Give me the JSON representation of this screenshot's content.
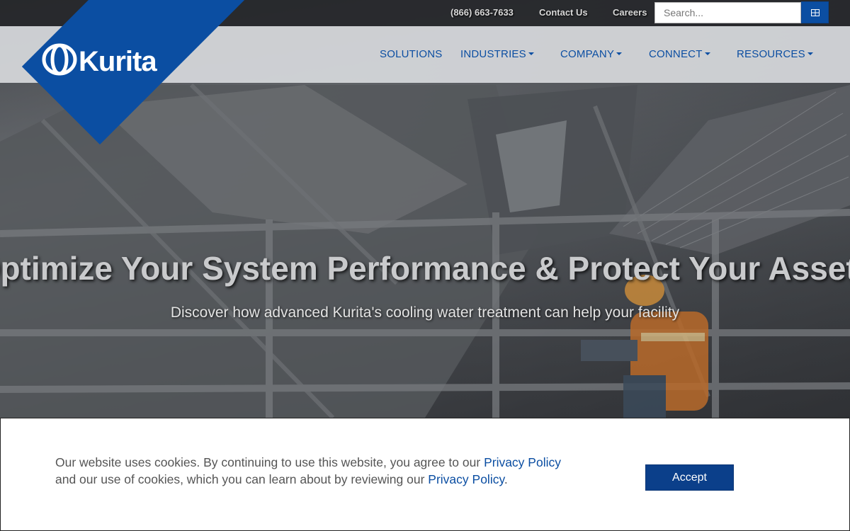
{
  "topbar": {
    "phone": "(866) 663-7633",
    "contact": "Contact Us",
    "careers": "Careers",
    "search_placeholder": "Search...",
    "search_button_icon": "grid-icon"
  },
  "brand": {
    "name": "Kurita",
    "color": "#0b4ea2"
  },
  "nav": {
    "items": [
      {
        "label": "SOLUTIONS",
        "dropdown": false
      },
      {
        "label": "INDUSTRIES",
        "dropdown": true
      },
      {
        "label": "COMPANY",
        "dropdown": true
      },
      {
        "label": "CONNECT",
        "dropdown": true
      },
      {
        "label": "RESOURCES",
        "dropdown": true
      }
    ]
  },
  "hero": {
    "title": "Optimize Your System Performance & Protect Your Assets",
    "subtitle": "Discover how advanced Kurita's cooling water treatment can help your facility"
  },
  "cookie": {
    "text_1": "Our website uses cookies. By continuing to use this website, you agree to our ",
    "link_1": "Privacy Policy",
    "text_2": "and our use of cookies, which you can learn about by reviewing our ",
    "link_2": "Privacy Policy",
    "text_3": ".",
    "accept_label": "Accept"
  }
}
